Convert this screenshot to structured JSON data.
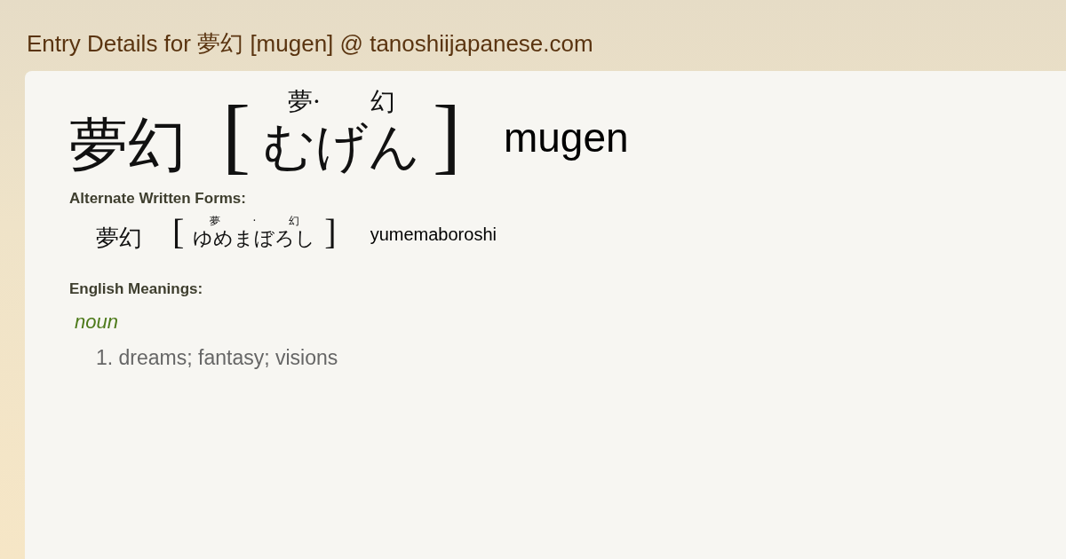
{
  "page_title": "Entry Details for 夢幻 [mugen] @ tanoshiijapanese.com",
  "entry": {
    "kanji": "夢幻",
    "open": "[",
    "furigana": [
      "夢·",
      "幻"
    ],
    "reading": "むげん",
    "close": "]",
    "romaji": "mugen"
  },
  "alternate": {
    "heading": "Alternate Written Forms:",
    "forms": [
      {
        "kanji": "夢幻",
        "open": "[",
        "furigana": [
          "夢",
          "·",
          "幻"
        ],
        "reading": "ゆめまぼろし",
        "close": "]",
        "romaji": "yumemaboroshi"
      }
    ]
  },
  "meanings": {
    "heading": "English Meanings:",
    "groups": [
      {
        "pos": "noun",
        "senses": [
          "1. dreams; fantasy; visions"
        ]
      }
    ]
  }
}
